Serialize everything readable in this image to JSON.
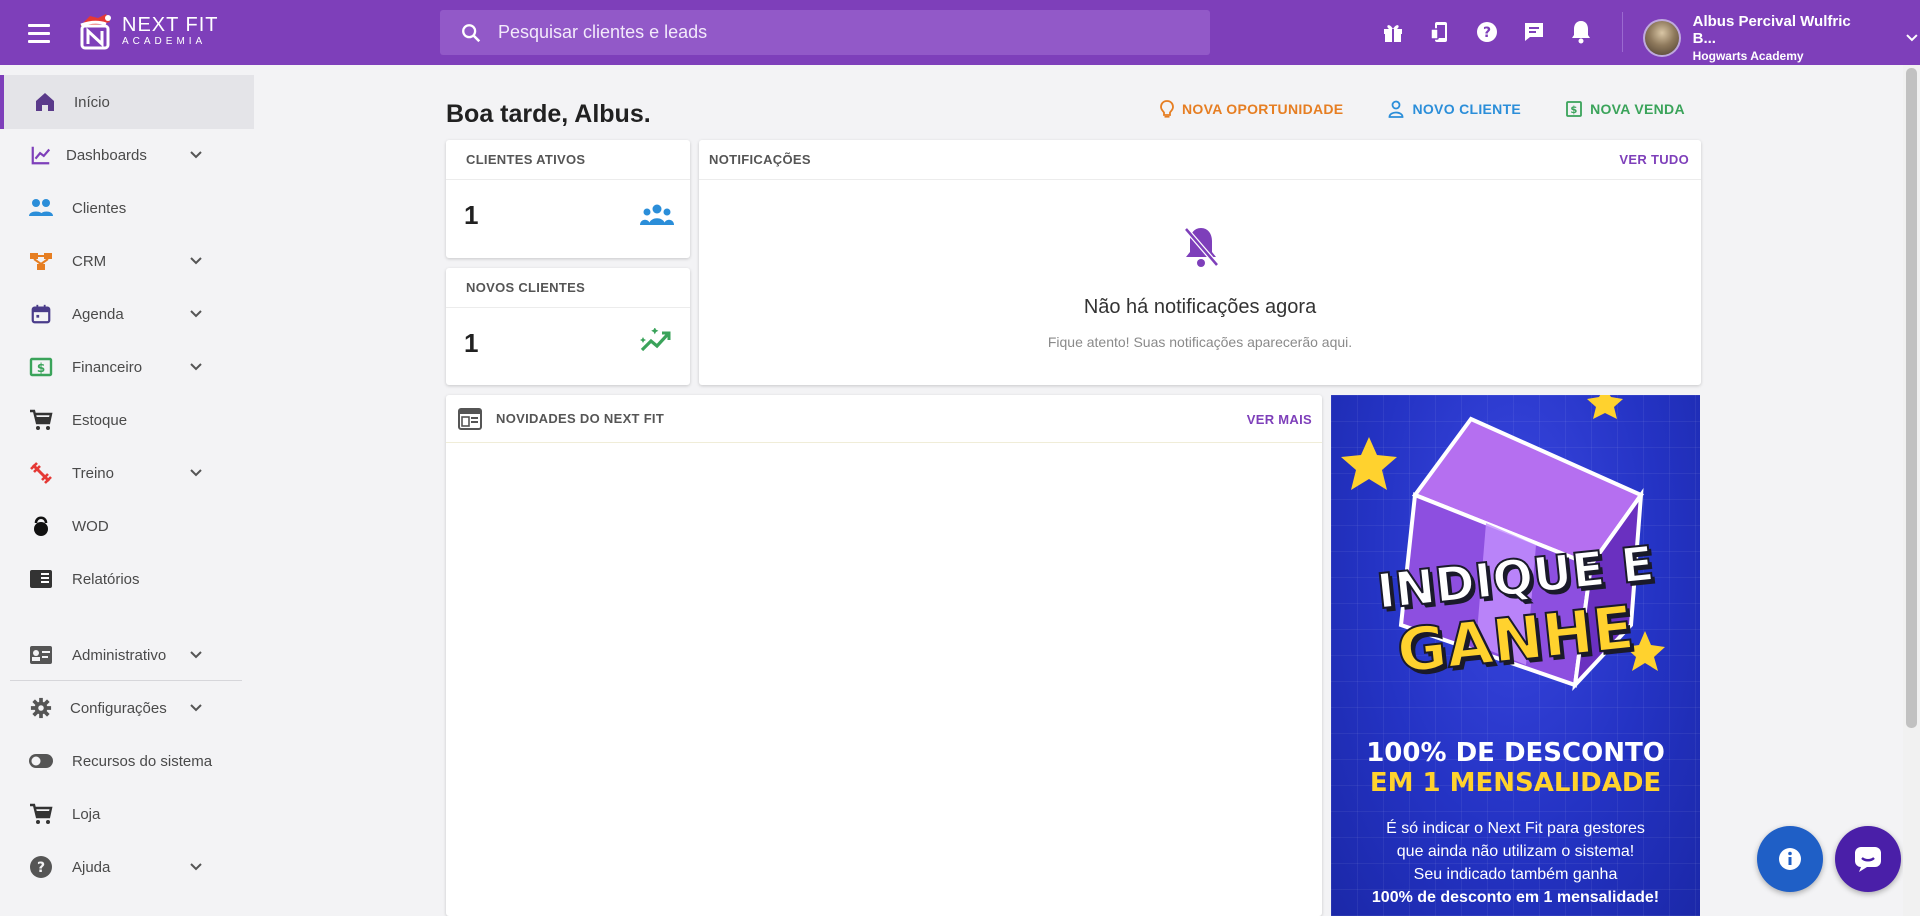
{
  "topbar": {
    "logo_main": "NEXT FIT",
    "logo_sub": "ACADEMIA",
    "search_placeholder": "Pesquisar clientes e leads",
    "user_name": "Albus Percival Wulfric B...",
    "user_org": "Hogwarts Academy"
  },
  "sidebar": {
    "items": [
      {
        "label": "Início",
        "icon": "home-icon"
      },
      {
        "label": "Dashboards",
        "icon": "chart-line-icon"
      },
      {
        "label": "Clientes",
        "icon": "people-icon"
      },
      {
        "label": "CRM",
        "icon": "crm-icon"
      },
      {
        "label": "Agenda",
        "icon": "calendar-icon"
      },
      {
        "label": "Financeiro",
        "icon": "money-icon"
      },
      {
        "label": "Estoque",
        "icon": "cart-icon"
      },
      {
        "label": "Treino",
        "icon": "dumbbell-icon"
      },
      {
        "label": "WOD",
        "icon": "kettlebell-icon"
      },
      {
        "label": "Relatórios",
        "icon": "report-icon"
      },
      {
        "label": "Administrativo",
        "icon": "id-card-icon"
      },
      {
        "label": "Configurações",
        "icon": "gear-icon"
      },
      {
        "label": "Recursos do sistema",
        "icon": "toggle-icon"
      },
      {
        "label": "Loja",
        "icon": "cart-icon"
      },
      {
        "label": "Ajuda",
        "icon": "help-icon"
      }
    ]
  },
  "main": {
    "greeting": "Boa tarde, Albus.",
    "actions": {
      "opportunity": "NOVA OPORTUNIDADE",
      "client": "NOVO CLIENTE",
      "sale": "NOVA VENDA"
    },
    "active_clients": {
      "label": "CLIENTES ATIVOS",
      "value": "1"
    },
    "new_clients": {
      "label": "NOVOS CLIENTES",
      "value": "1"
    },
    "notifications": {
      "title": "NOTIFICAÇÕES",
      "link": "VER TUDO",
      "empty_title": "Não há notificações agora",
      "empty_sub": "Fique atento! Suas notificações aparecerão aqui."
    },
    "news": {
      "title": "NOVIDADES DO NEXT FIT",
      "link": "VER MAIS"
    },
    "banner": {
      "title1": "INDIQUE E",
      "title2": "GANHE",
      "line1": "100% DE DESCONTO",
      "line2": "EM 1 MENSALIDADE",
      "body1": "É só indicar o Next Fit para gestores",
      "body2": "que ainda não utilizam o sistema!",
      "body3": "Seu indicado também ganha",
      "body4": "100% de desconto em 1 mensalidade!"
    }
  },
  "colors": {
    "brand": "#7e3fba",
    "opportunity": "#e67e22",
    "client": "#2b8ed9",
    "sale": "#3aa35a"
  }
}
